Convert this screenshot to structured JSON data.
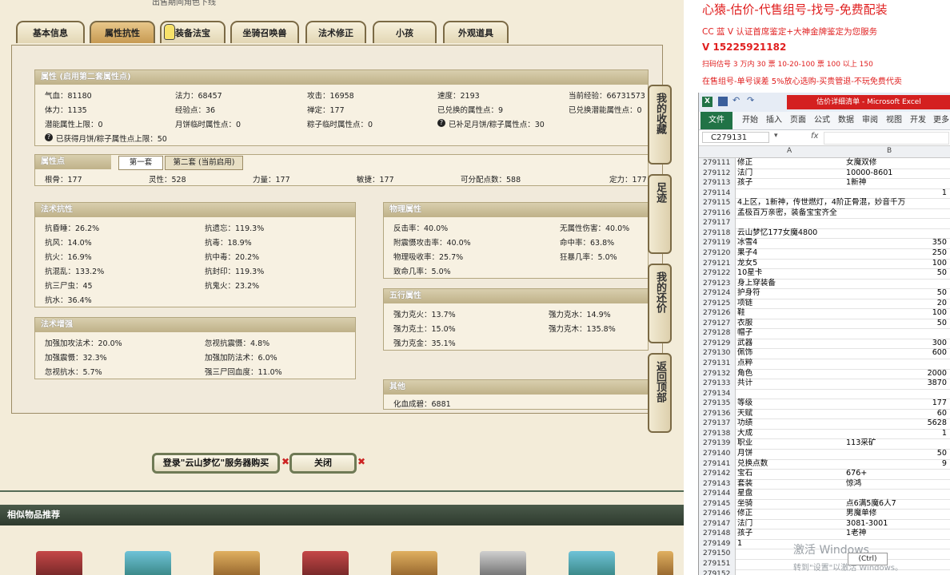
{
  "tabs": [
    {
      "label": "基本信息",
      "active": false
    },
    {
      "label": "属性抗性",
      "active": true
    },
    {
      "label": "装备法宝",
      "active": false
    },
    {
      "label": "坐骑召唤兽",
      "active": false
    },
    {
      "label": "法术修正",
      "active": false
    },
    {
      "label": "小孩",
      "active": false
    },
    {
      "label": "外观道具",
      "active": false
    }
  ],
  "attr_section": {
    "title": "属性 (启用第二套属性点)",
    "rows": [
      [
        "气血：81180",
        "法力：68457",
        "攻击：16958",
        "速度：2193",
        "当前经验：66731573"
      ],
      [
        "体力：1135",
        "经验点：36",
        "禅定：177",
        "已兑换的属性点：9",
        "已兑换潜能属性点：0"
      ],
      [
        "潜能属性上限：0",
        "月饼临时属性点：0",
        "粽子临时属性点：0",
        "已补足月饼/粽子属性点：30",
        ""
      ]
    ],
    "note": "已获得月饼/粽子属性点上限：50"
  },
  "points_section": {
    "title": "属性点",
    "tab1": "第一套",
    "tab2": "第二套 (当前启用)",
    "row": [
      "根骨：177",
      "灵性：528",
      "力量：177",
      "敏捷：177",
      "可分配点数：588",
      "定力：177"
    ]
  },
  "magic_resist": {
    "title": "法术抗性",
    "rows": [
      [
        "抗昏睡：26.2%",
        "抗遗忘：119.3%"
      ],
      [
        "抗风：14.0%",
        "抗毒：18.9%"
      ],
      [
        "抗火：16.9%",
        "抗中毒：20.2%"
      ],
      [
        "抗混乱：133.2%",
        "抗封印：119.3%"
      ],
      [
        "抗三尸虫：45",
        "抗鬼火：23.2%"
      ],
      [
        "抗水：36.4%",
        ""
      ]
    ]
  },
  "magic_boost": {
    "title": "法术增强",
    "rows": [
      [
        "加强加攻法术：20.0%",
        "忽视抗震慑：4.8%"
      ],
      [
        "加强震慑：32.3%",
        "加强加防法术：6.0%"
      ],
      [
        "忽视抗水：5.7%",
        "强三尸回血度：11.0%"
      ]
    ]
  },
  "phys_attr": {
    "title": "物理属性",
    "rows": [
      [
        "反击率：40.0%",
        "无属性伤害：40.0%"
      ],
      [
        "附震慑攻击率：40.0%",
        "命中率：63.8%"
      ],
      [
        "物理吸收率：25.7%",
        "狂暴几率：5.0%"
      ],
      [
        "致命几率：5.0%",
        ""
      ]
    ]
  },
  "five_attr": {
    "title": "五行属性",
    "rows": [
      [
        "强力克火：13.7%",
        "强力克水：14.9%"
      ],
      [
        "强力克土：15.0%",
        "强力克木：135.8%"
      ],
      [
        "强力克金：35.1%",
        ""
      ]
    ]
  },
  "other": {
    "title": "其他",
    "value": "化血成碧：6881"
  },
  "side_buttons": [
    "我的收藏",
    "足迹",
    "我的还价",
    "返回顶部"
  ],
  "buy_button": "登录\"云山梦忆\"服务器购买",
  "close_button": "关闭",
  "similar_title": "相似物品推荐",
  "top_cut_text": "出售期间角色下线",
  "ads": [
    {
      "text": "心猿-估价-代售组号-找号-免费配装",
      "size": 15,
      "bold": false
    },
    {
      "text": "CC 蓝 V 认证首席鉴定+大神金牌鉴定为您服务",
      "size": 10.5,
      "bold": false
    },
    {
      "text": "V 15225921182",
      "size": 12,
      "bold": true
    },
    {
      "text": "扫码估号 3 万内 30 票 10-20-100 票 100 以上 150",
      "size": 9,
      "bold": false
    },
    {
      "text": "在售组号-单号误差 5%放心选购-买贵管退-不玩免费代卖",
      "size": 10,
      "bold": false
    }
  ],
  "excel": {
    "title": "估价详细清单 - Microsoft Excel",
    "ribbon_tabs": [
      "文件",
      "开始",
      "插入",
      "页面",
      "公式",
      "数据",
      "审阅",
      "视图",
      "开发",
      "更多"
    ],
    "name_box": "C279131",
    "fx": "fx",
    "col_a": "A",
    "col_b": "B",
    "rows": [
      {
        "n": "279111",
        "a": "修正",
        "b": "女魔双修",
        "num": false
      },
      {
        "n": "279112",
        "a": "法门",
        "b": "10000-8601",
        "num": false
      },
      {
        "n": "279113",
        "a": "孩子",
        "b": "1新神",
        "num": false
      },
      {
        "n": "279114",
        "a": "",
        "b": "1",
        "num": true
      },
      {
        "n": "279115",
        "a": "4上区，1新神，传世燃灯，4阶正骨混，妙音千万",
        "b": "",
        "num": false
      },
      {
        "n": "279116",
        "a": "孟极百万亲密，装备宝宝齐全",
        "b": "",
        "num": false
      },
      {
        "n": "279117",
        "a": "",
        "b": "",
        "num": false
      },
      {
        "n": "279118",
        "a": "云山梦忆177女魔4800",
        "b": "",
        "num": false
      },
      {
        "n": "279119",
        "a": "冰雪4",
        "b": "350",
        "num": true
      },
      {
        "n": "279120",
        "a": "果子4",
        "b": "250",
        "num": true
      },
      {
        "n": "279121",
        "a": "龙女5",
        "b": "100",
        "num": true
      },
      {
        "n": "279122",
        "a": "10星卡",
        "b": "50",
        "num": true
      },
      {
        "n": "279123",
        "a": "身上穿装备",
        "b": "",
        "num": false
      },
      {
        "n": "279124",
        "a": "护身符",
        "b": "50",
        "num": true
      },
      {
        "n": "279125",
        "a": "项链",
        "b": "20",
        "num": true
      },
      {
        "n": "279126",
        "a": "鞋",
        "b": "100",
        "num": true
      },
      {
        "n": "279127",
        "a": "衣服",
        "b": "50",
        "num": true
      },
      {
        "n": "279128",
        "a": "帽子",
        "b": "",
        "num": false
      },
      {
        "n": "279129",
        "a": "武器",
        "b": "300",
        "num": true
      },
      {
        "n": "279130",
        "a": "佩饰",
        "b": "600",
        "num": true
      },
      {
        "n": "279131",
        "a": "点粹",
        "b": "",
        "num": false
      },
      {
        "n": "279132",
        "a": "角色",
        "b": "2000",
        "num": true
      },
      {
        "n": "279133",
        "a": "共计",
        "b": "3870",
        "num": true
      },
      {
        "n": "279134",
        "a": "",
        "b": "",
        "num": false
      },
      {
        "n": "279135",
        "a": "等级",
        "b": "177",
        "num": true
      },
      {
        "n": "279136",
        "a": "天赋",
        "b": "60",
        "num": true
      },
      {
        "n": "279137",
        "a": "功绩",
        "b": "5628",
        "num": true
      },
      {
        "n": "279138",
        "a": "大成",
        "b": "1",
        "num": true
      },
      {
        "n": "279139",
        "a": "职业",
        "b": "113采矿",
        "num": false
      },
      {
        "n": "279140",
        "a": "月饼",
        "b": "50",
        "num": true
      },
      {
        "n": "279141",
        "a": "兑换点数",
        "b": "9",
        "num": true
      },
      {
        "n": "279142",
        "a": "宝石",
        "b": "676+",
        "num": false
      },
      {
        "n": "279143",
        "a": "套装",
        "b": "惊鸿",
        "num": false
      },
      {
        "n": "279144",
        "a": "星盘",
        "b": "",
        "num": false
      },
      {
        "n": "279145",
        "a": "坐骑",
        "b": "点6满5魔6人7",
        "num": false
      },
      {
        "n": "279146",
        "a": "修正",
        "b": "男魔单修",
        "num": false
      },
      {
        "n": "279147",
        "a": "法门",
        "b": "3081-3001",
        "num": false
      },
      {
        "n": "279148",
        "a": "孩子",
        "b": "1老神",
        "num": false
      },
      {
        "n": "279149",
        "a": "1",
        "b": "",
        "num": false
      },
      {
        "n": "279150",
        "a": "",
        "b": "",
        "num": false
      },
      {
        "n": "279151",
        "a": "",
        "b": "",
        "num": false
      },
      {
        "n": "279152",
        "a": "",
        "b": "",
        "num": false
      }
    ],
    "ctrl_tag": "(Ctrl)",
    "watermark1": "激活 Windows",
    "watermark2": "转到\"设置\"以激活 Windows。"
  }
}
